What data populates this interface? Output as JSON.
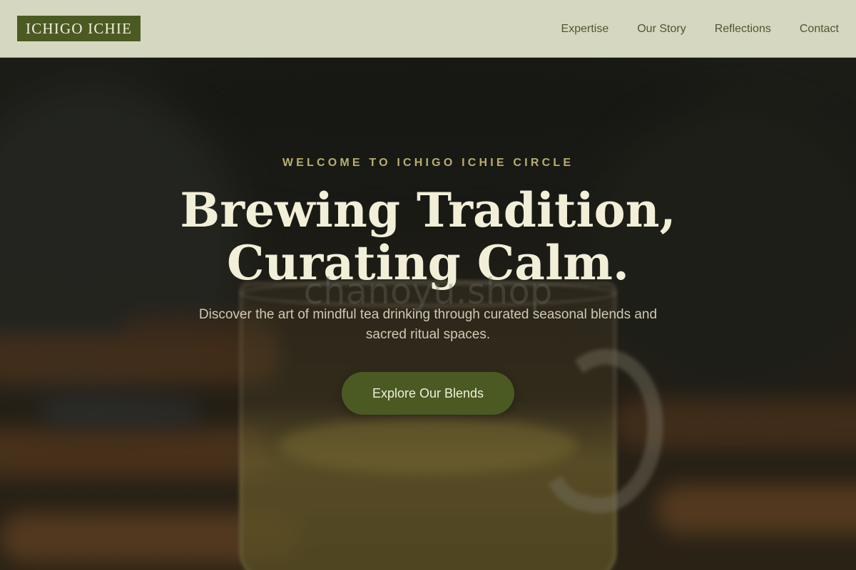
{
  "header": {
    "logo": "ICHIGO ICHIE",
    "nav": [
      {
        "label": "Expertise"
      },
      {
        "label": "Our Story"
      },
      {
        "label": "Reflections"
      },
      {
        "label": "Contact"
      }
    ]
  },
  "hero": {
    "eyebrow": "WELCOME TO ICHIGO ICHIE CIRCLE",
    "headline_line1": "Brewing Tradition,",
    "headline_line2": "Curating Calm.",
    "watermark": "chanoyu.shop",
    "subtitle": "Discover the art of mindful tea drinking through curated seasonal blends and sacred ritual spaces.",
    "cta_label": "Explore Our Blends",
    "background_image": "blurred glass cup of green tea on wooden slats"
  },
  "colors": {
    "brand_green": "#4b5a22",
    "header_bg": "#dedfc8",
    "eyebrow_gold": "#b9ae6e",
    "headline_cream": "#f2efd8"
  }
}
